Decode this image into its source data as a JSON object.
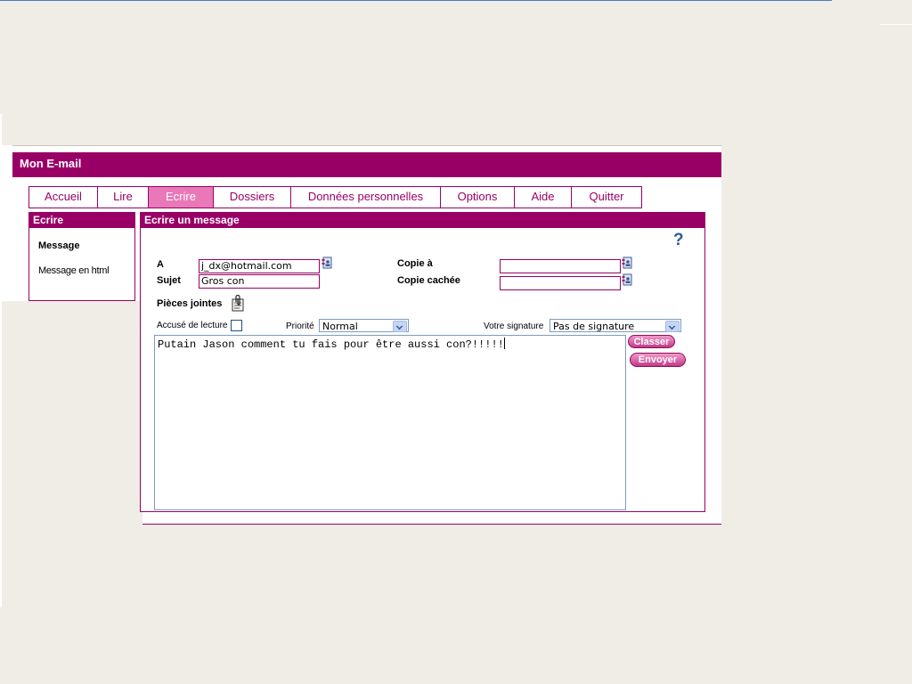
{
  "app": {
    "title": "Mon E-mail"
  },
  "tabs": [
    {
      "label": "Accueil",
      "active": false
    },
    {
      "label": "Lire",
      "active": false
    },
    {
      "label": "Ecrire",
      "active": true
    },
    {
      "label": "Dossiers",
      "active": false
    },
    {
      "label": "Données personnelles",
      "active": false
    },
    {
      "label": "Options",
      "active": false
    },
    {
      "label": "Aide",
      "active": false
    },
    {
      "label": "Quitter",
      "active": false
    }
  ],
  "sidebar": {
    "title": "Ecrire",
    "items": [
      {
        "label": "Message"
      },
      {
        "label": "Message en html"
      }
    ]
  },
  "compose": {
    "title": "Ecrire un message",
    "help_symbol": "?",
    "to_label": "A",
    "to_value": "j_dx@hotmail.com",
    "subject_label": "Sujet",
    "subject_value": "Gros con",
    "cc_label": "Copie à",
    "cc_value": "",
    "bcc_label": "Copie cachée",
    "bcc_value": "",
    "attachments_label": "Pièces jointes",
    "read_receipt_label": "Accusé de lecture",
    "read_receipt_checked": false,
    "priority_label": "Priorité",
    "priority_value": "Normal",
    "signature_label": "Votre signature",
    "signature_value": "Pas de signature",
    "body": "Putain Jason comment tu fais pour être aussi con?!!!!!",
    "classer_label": "Classer",
    "send_label": "Envoyer"
  },
  "colors": {
    "brand": "#990066",
    "active_tab": "#e878b8",
    "background": "#efede6",
    "help_blue": "#2a5c9a"
  },
  "icons": [
    "address-book-icon",
    "paperclip-icon",
    "chevron-down-icon"
  ]
}
